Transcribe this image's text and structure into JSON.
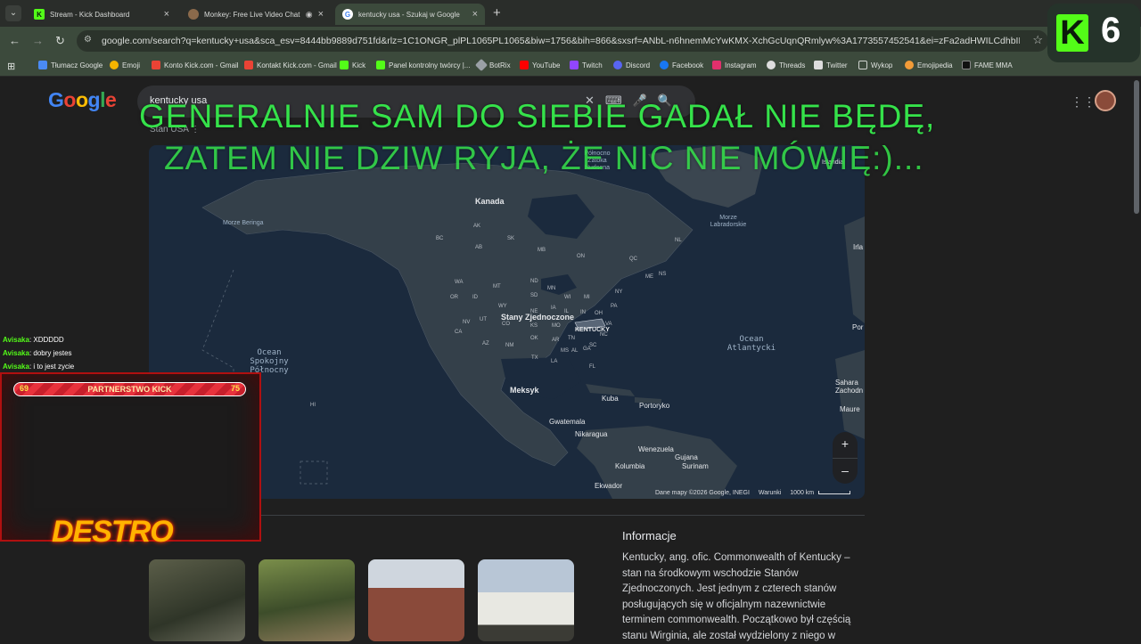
{
  "browser": {
    "tabs": [
      {
        "title": "Stream - Kick Dashboard",
        "active": false
      },
      {
        "title": "Monkey: Free Live Video Chat",
        "active": false
      },
      {
        "title": "kentucky usa - Szukaj w Google",
        "active": true
      }
    ],
    "url": "google.com/search?q=kentucky+usa&sca_esv=8444bb9889d751fd&rlz=1C1ONGR_plPL1065PL1065&biw=1756&bih=866&sxsrf=ANbL-n6hnemMcYwKMX-XchGcUqnQRmlyw%3A1773557452541&ei=zFa2adHWILCdhbIP0lvy0A...",
    "bookmarks": [
      "Tłumacz Google",
      "Emoji",
      "Konto Kick.com - Gmail",
      "Kontakt Kick.com - Gmail",
      "Kick",
      "Panel kontrolny twórcy |...",
      "BotRix",
      "YouTube",
      "Twitch",
      "Discord",
      "Facebook",
      "Instagram",
      "Threads",
      "Twitter",
      "Wykop",
      "Emojipedia",
      "FAME MMA"
    ]
  },
  "kick_badge": {
    "number": "6"
  },
  "google": {
    "logo": "Google",
    "query": "kentucky usa",
    "breadcrumb": "Stan USA",
    "map": {
      "labels": {
        "canada": "Kanada",
        "usa": "Stany Zjednoczone",
        "kentucky": "KENTUCKY",
        "mexico": "Meksyk",
        "cuba": "Kuba",
        "puerto_rico": "Portoryko",
        "guatemala": "Gwatemala",
        "nicaragua": "Nikaragua",
        "venezuela": "Wenezuela",
        "guyana": "Gujana",
        "suriname": "Surinam",
        "colombia": "Kolumbia",
        "ecuador": "Ekwador",
        "bering": "Morze Beringa",
        "labrador": "Morze Labradorskie",
        "hudson": "Północno Zatoka Hudsona",
        "pacific": "Ocean Spokojny Północny",
        "atlantic": "Ocean Atlantycki",
        "iceland": "Islandia",
        "ireland": "Irla",
        "portugal": "Por",
        "sahara": "Sahara Zachodn",
        "mauritania": "Maure",
        "hawaii": "HI"
      },
      "states": [
        "AK",
        "BC",
        "SK",
        "AB",
        "MB",
        "ON",
        "QC",
        "NL",
        "WA",
        "OR",
        "ID",
        "MT",
        "ND",
        "MN",
        "WI",
        "MI",
        "NY",
        "ME",
        "NV",
        "UT",
        "WY",
        "SD",
        "NE",
        "IA",
        "IL",
        "IN",
        "OH",
        "PA",
        "CA",
        "AZ",
        "CO",
        "KS",
        "MO",
        "TN",
        "VA",
        "NM",
        "OK",
        "AR",
        "NC",
        "SC",
        "TX",
        "LA",
        "MS",
        "AL",
        "GA",
        "FL",
        "NS"
      ],
      "attribution": "Dane mapy ©2026 Google, INEGI",
      "terms": "Warunki",
      "scale": "1000 km",
      "zoom_in": "+",
      "zoom_out": "–"
    },
    "info": {
      "heading": "Informacje",
      "text": "Kentucky, ang. ofic. Commonwealth of Kentucky – stan na środkowym wschodzie Stanów Zjednoczonych. Jest jednym z czterech stanów posługujących się w oficjalnym nazewnictwie terminem commonwealth. Początkowo był częścią stanu Wirginia, ale został wydzielony z niego w"
    }
  },
  "overlay": {
    "line1": "GENERALNIE SAM DO SIEBIE GADAŁ NIE BĘDĘ,",
    "line2": "ZATEM NIE DZIW RYJA, ŻE NIC NIE MÓWIĘ:)..."
  },
  "chat": [
    {
      "user": "Avisaka",
      "msg": ": XDDDDD"
    },
    {
      "user": "Avisaka",
      "msg": ": dobry jestes"
    },
    {
      "user": "Avisaka",
      "msg": ": i to jest zycie"
    }
  ],
  "partner_bar": {
    "left": "69",
    "label": "PARTNERSTWO KICK",
    "right": "75",
    "progress": 0.92
  },
  "streamer_logo": "DESTRO",
  "colors": {
    "kick_green": "#53fc18",
    "overlay_green": "#35e24a",
    "map_water": "#1b2a3d",
    "map_land": "#34404a"
  }
}
